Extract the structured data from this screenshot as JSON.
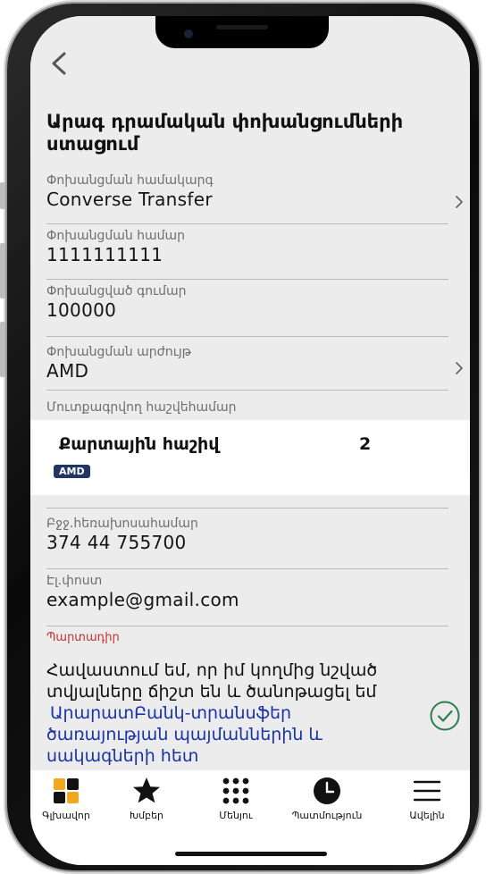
{
  "header": {
    "title": "Արագ դրամական փոխանցումների ստացում"
  },
  "form": {
    "system": {
      "label": "Փոխանցման համակարգ",
      "value": "Converse Transfer"
    },
    "transfer_number": {
      "label": "Փոխանցման համար",
      "value": "1111111111"
    },
    "amount": {
      "label": "Փոխանցված գումար",
      "value": "100000"
    },
    "currency": {
      "label": "Փոխանցման արժույթ",
      "value": "AMD"
    },
    "receiving_account_label": "Մուտքագրվող հաշվեհամար",
    "phone": {
      "label": "Բջջ.հեռախոսահամար",
      "value": "374 44 755700"
    },
    "email": {
      "label": "Էլ.փոստ",
      "value": "example@gmail.com"
    },
    "required_label": "Պարտադիր"
  },
  "account_card": {
    "name": "Քարտային հաշիվ",
    "number": "2",
    "currency_badge": "AMD"
  },
  "consent": {
    "text": "Հավաստում եմ, որ իմ կողմից նշված տվյալները ճիշտ են և ծանոթացել եմ",
    "link_line1": "ԱրարատԲանկ-տրանսֆեր",
    "link_line2": "ծառայության պայմաններին և",
    "link_line3": "սակագների հետ",
    "checked": true
  },
  "tabbar": {
    "items": [
      {
        "label": "Գլխավոր",
        "icon": "grid-icon"
      },
      {
        "label": "Խմբեր",
        "icon": "star-icon"
      },
      {
        "label": "Մենյու",
        "icon": "dots-grid-icon"
      },
      {
        "label": "Պատմություն",
        "icon": "clock-icon"
      },
      {
        "label": "Ավելին",
        "icon": "hamburger-icon"
      }
    ]
  },
  "colors": {
    "accent_orange": "#f2a81d",
    "link_blue": "#1a33a8",
    "badge_navy": "#233563",
    "check_green": "#2e7d4f",
    "required_red": "#c83131"
  }
}
